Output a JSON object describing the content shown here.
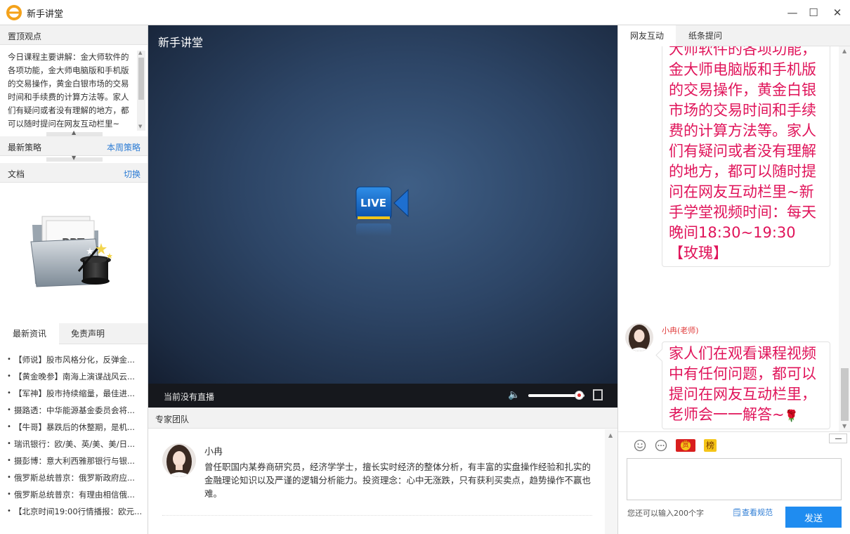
{
  "window": {
    "title": "新手讲堂",
    "minimize": "—",
    "maximize": "☐",
    "close": "✕"
  },
  "left": {
    "pinned": {
      "heading": "置顶观点",
      "text": "今日课程主要讲解：金大师软件的各项功能，金大师电脑版和手机版的交易操作，黄金白银市场的交易时间和手续费的计算方法等。家人们有疑问或者没有理解的地方，都可以随时提问在网友互动栏里~"
    },
    "strategy": {
      "heading": "最新策略",
      "link": "本周策略"
    },
    "docs": {
      "heading": "文档",
      "link": "切换",
      "ppt_label": "PPT"
    },
    "news_tabs": [
      "最新资讯",
      "免责声明"
    ],
    "news": [
      "【师说】股市风格分化，反弹金...",
      "【黄金晚参】南海上演谍战风云...",
      "【军神】股市持续缩量，最佳进...",
      "摄路透：中华能源基金委员会将...",
      "【牛哥】暴跌后的休整期，是机...",
      "瑞讯银行：欧/美、英/美、美/日...",
      "摄彭博：意大利西雅那银行与银...",
      "俄罗斯总统普京：俄罗斯政府应...",
      "俄罗斯总统普京：有理由相信俄...",
      "【北京时间19:00行情播报：欧元..."
    ]
  },
  "video": {
    "title": "新手讲堂",
    "live_badge": "LIVE",
    "status": "当前没有直播",
    "volume": 0.9
  },
  "experts": {
    "heading": "专家团队",
    "name": "小冉",
    "description": "曾任职国内某券商研究员，经济学学士，擅长实时经济的整体分析，有丰富的实盘操作经验和扎实的金融理论知识以及严谨的逻辑分析能力。投资理念：心中无涨跌，只有获利买卖点，趋势操作不赢也难。"
  },
  "chat": {
    "tabs": [
      "网友互动",
      "纸条提问"
    ],
    "messages": [
      {
        "text": "今日课程主要讲解：金大师软件的各项功能，金大师电脑版和手机版的交易操作，黄金白银市场的交易时间和手续费的计算方法等。家人们有疑问或者没有理解的地方，都可以随时提问在网友互动栏里~新手学堂视频时间：每天晚间18:30~19:30【玫瑰】"
      },
      {
        "sender": "小冉(老师)",
        "text": "家人们在观看课程视频中有任何问题，都可以提问在网友互动栏里，老师会一一解答~"
      }
    ],
    "rose_emoji": "🌹",
    "tools": {
      "gift": "赏",
      "rank": "榜"
    },
    "input_placeholder": "",
    "char_count": "您还可以输入200个字",
    "rules_link": "查看规范",
    "send": "发送",
    "accent_color": "#1f8cf0",
    "message_color": "#e0145a"
  }
}
